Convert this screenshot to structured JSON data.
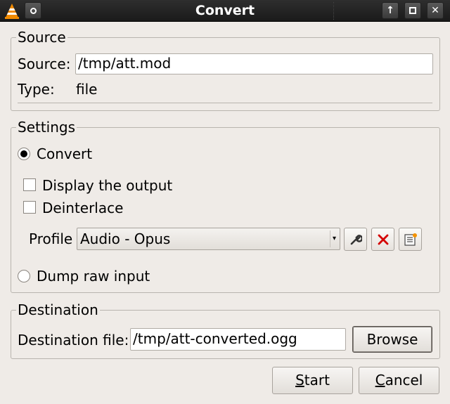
{
  "window": {
    "title": "Convert"
  },
  "source": {
    "group_title": "Source",
    "source_label": "Source:",
    "source_value": "/tmp/att.mod",
    "type_label": "Type:",
    "type_value": "file"
  },
  "settings": {
    "group_title": "Settings",
    "convert_label": "Convert",
    "display_output_label": "Display the output",
    "deinterlace_label": "Deinterlace",
    "profile_label": "Profile",
    "profile_value": "Audio - Opus",
    "dump_raw_label": "Dump raw input"
  },
  "destination": {
    "group_title": "Destination",
    "file_label": "Destination file:",
    "file_value": "/tmp/att-converted.ogg",
    "browse_label": "Browse"
  },
  "actions": {
    "start_accel": "S",
    "start_rest": "tart",
    "cancel_accel": "C",
    "cancel_rest": "ancel"
  }
}
